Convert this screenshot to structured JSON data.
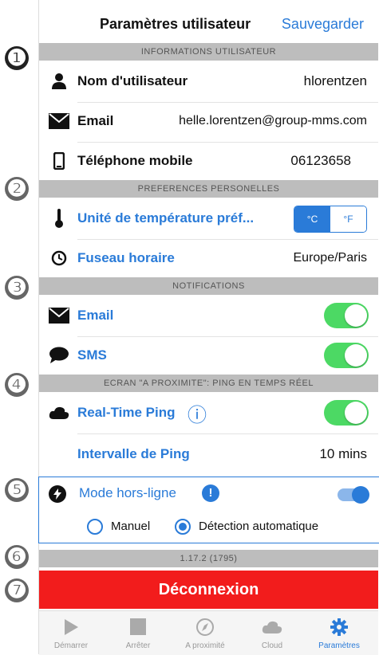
{
  "header": {
    "title": "Paramètres utilisateur",
    "save_label": "Sauvegarder"
  },
  "badges": [
    "❶",
    "❷",
    "❸",
    "❹",
    "❺",
    "❻",
    "❼"
  ],
  "sections": {
    "user_info": "INFORMATIONS UTILISATEUR",
    "preferences": "PREFERENCES PERSONELLES",
    "notifications": "NOTIFICATIONS",
    "nearby": "ECRAN \"A PROXIMITE\": PING EN TEMPS RÉEL",
    "version": "1.17.2 (1795)"
  },
  "user": {
    "name_label": "Nom d'utilisateur",
    "name_value": "hlorentzen",
    "email_label": "Email",
    "email_value": "helle.lorentzen@group-mms.com",
    "phone_label": "Téléphone mobile",
    "phone_value": "06123658"
  },
  "prefs": {
    "temp_label": "Unité de température préf...",
    "temp_options": [
      "°C",
      "°F"
    ],
    "temp_selected": "°C",
    "tz_label": "Fuseau horaire",
    "tz_value": "Europe/Paris"
  },
  "notifications": {
    "email_label": "Email",
    "email_on": true,
    "sms_label": "SMS",
    "sms_on": true
  },
  "ping": {
    "label": "Real-Time Ping",
    "info_icon": "ⓘ",
    "on": true,
    "interval_label": "Intervalle de Ping",
    "interval_value": "10 mins"
  },
  "offline": {
    "label": "Mode hors-ligne",
    "on": true,
    "manual_label": "Manuel",
    "auto_label": "Détection automatique",
    "selected": "auto"
  },
  "logout_label": "Déconnexion",
  "tabs": [
    {
      "label": "Démarrer",
      "icon": "play-icon",
      "active": false
    },
    {
      "label": "Arrêter",
      "icon": "stop-icon",
      "active": false
    },
    {
      "label": "A proximité",
      "icon": "compass-icon",
      "active": false
    },
    {
      "label": "Cloud",
      "icon": "cloud-icon",
      "active": false
    },
    {
      "label": "Paramètres",
      "icon": "gear-icon",
      "active": true
    }
  ],
  "colors": {
    "accent": "#2a7bd8",
    "toggle_on": "#4cd964",
    "logout": "#f21c1c",
    "section_bg": "#bdbdbd"
  }
}
